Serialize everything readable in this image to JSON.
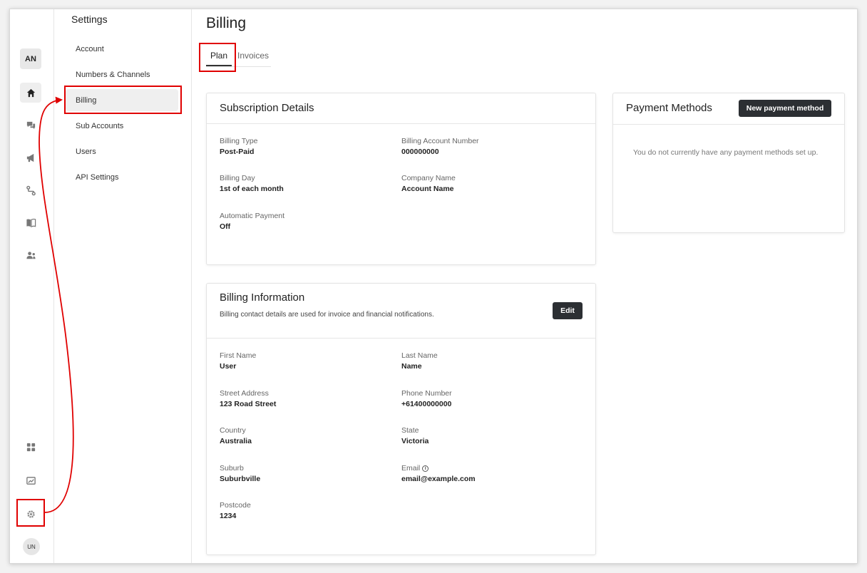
{
  "rail": {
    "avatar_top": "AN",
    "avatar_bottom": "UN",
    "icons": [
      "home-icon",
      "chat-icon",
      "megaphone-icon",
      "route-icon",
      "book-icon",
      "contacts-icon",
      "apps-icon",
      "analytics-icon",
      "gear-icon"
    ]
  },
  "sidebar": {
    "title": "Settings",
    "items": [
      {
        "label": "Account"
      },
      {
        "label": "Numbers & Channels"
      },
      {
        "label": "Billing"
      },
      {
        "label": "Sub Accounts"
      },
      {
        "label": "Users"
      },
      {
        "label": "API Settings"
      }
    ]
  },
  "main": {
    "title": "Billing",
    "tabs": [
      {
        "label": "Plan"
      },
      {
        "label": "Invoices"
      }
    ],
    "subscription": {
      "title": "Subscription Details",
      "fields": [
        {
          "label": "Billing Type",
          "value": "Post-Paid"
        },
        {
          "label": "Billing Account Number",
          "value": "000000000"
        },
        {
          "label": "Billing Day",
          "value": "1st of each month"
        },
        {
          "label": "Company Name",
          "value": "Account Name"
        },
        {
          "label": "Automatic Payment",
          "value": "Off"
        }
      ]
    },
    "billing_info": {
      "title": "Billing Information",
      "subtitle": "Billing contact details are used for invoice and financial notifications.",
      "edit_label": "Edit",
      "fields": [
        {
          "label": "First Name",
          "value": "User"
        },
        {
          "label": "Last Name",
          "value": "Name"
        },
        {
          "label": "Street Address",
          "value": "123 Road Street"
        },
        {
          "label": "Phone Number",
          "value": "+61400000000"
        },
        {
          "label": "Country",
          "value": "Australia"
        },
        {
          "label": "State",
          "value": "Victoria"
        },
        {
          "label": "Suburb",
          "value": "Suburbville"
        },
        {
          "label": "Email",
          "value": "email@example.com"
        },
        {
          "label": "Postcode",
          "value": "1234"
        }
      ]
    },
    "payment_methods": {
      "title": "Payment Methods",
      "new_button": "New payment method",
      "empty_text": "You do not currently have any payment methods set up."
    }
  },
  "colors": {
    "highlight": "#e00000",
    "button_dark": "#2c2f33"
  }
}
